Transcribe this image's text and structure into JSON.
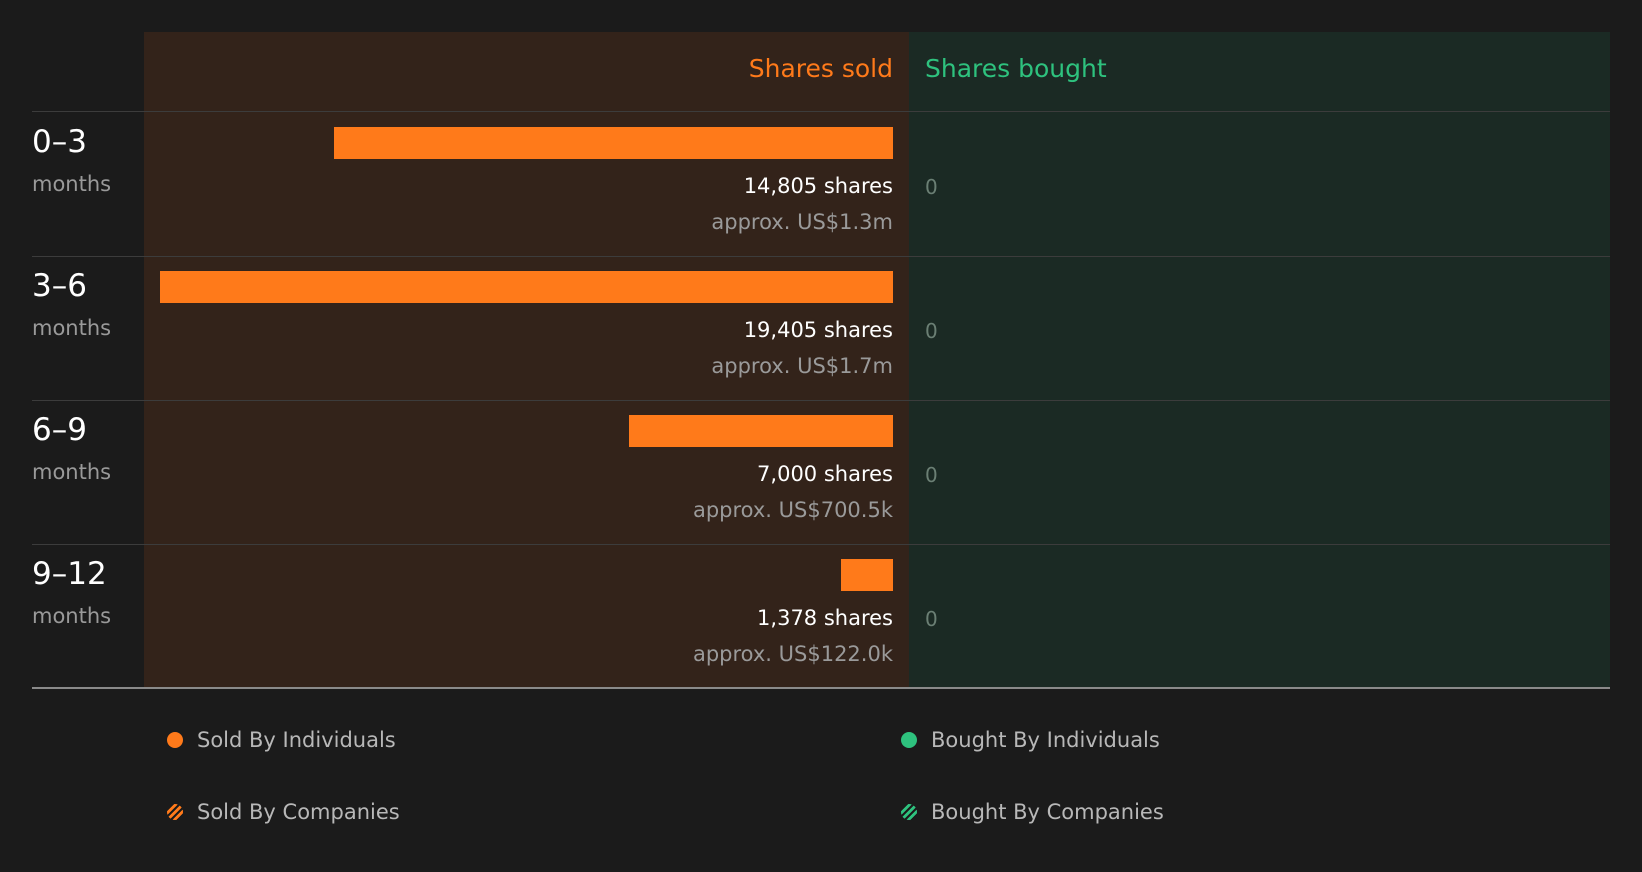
{
  "colors": {
    "sold": "#ff7a1a",
    "bought": "#2ec27e"
  },
  "headers": {
    "sold": "Shares sold",
    "bought": "Shares bought"
  },
  "chart_data": {
    "type": "bar",
    "orientation": "horizontal-diverging",
    "categories": [
      "0–3",
      "3–6",
      "6–9",
      "9–12"
    ],
    "category_unit": "months",
    "series": [
      {
        "name": "Shares sold",
        "values": [
          14805,
          19405,
          7000,
          1378
        ]
      },
      {
        "name": "Shares bought",
        "values": [
          0,
          0,
          0,
          0
        ]
      }
    ],
    "rows": [
      {
        "period": "0–3",
        "unit": "months",
        "shares_sold": 14805,
        "shares_label": "14,805 shares",
        "value_label": "approx. US$1.3m",
        "bought_label": "0"
      },
      {
        "period": "3–6",
        "unit": "months",
        "shares_sold": 19405,
        "shares_label": "19,405 shares",
        "value_label": "approx. US$1.7m",
        "bought_label": "0"
      },
      {
        "period": "6–9",
        "unit": "months",
        "shares_sold": 7000,
        "shares_label": "7,000 shares",
        "value_label": "approx. US$700.5k",
        "bought_label": "0"
      },
      {
        "period": "9–12",
        "unit": "months",
        "shares_sold": 1378,
        "shares_label": "1,378 shares",
        "value_label": "approx. US$122.0k",
        "bought_label": "0"
      }
    ],
    "legend": [
      {
        "label": "Sold By Individuals",
        "color": "#ff7a1a",
        "marker": "dot"
      },
      {
        "label": "Bought By Individuals",
        "color": "#2ec27e",
        "marker": "dot"
      },
      {
        "label": "Sold By Companies",
        "color": "#ff7a1a",
        "marker": "hatched-dot"
      },
      {
        "label": "Bought By Companies",
        "color": "#2ec27e",
        "marker": "hatched-dot"
      }
    ],
    "legend_position": "bottom"
  }
}
